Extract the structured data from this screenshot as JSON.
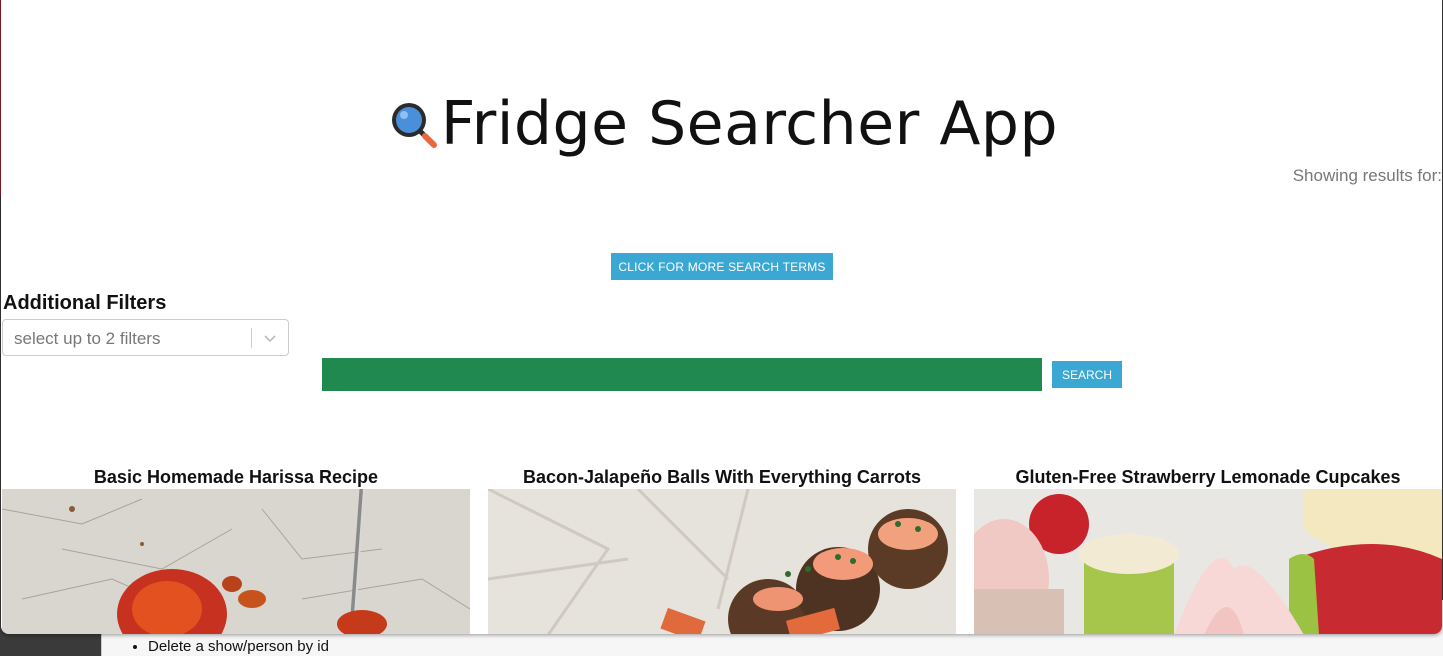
{
  "app": {
    "title": "Fridge Searcher App",
    "showing_results": "Showing results for:"
  },
  "buttons": {
    "more_terms": "CLICK FOR MORE SEARCH TERMS",
    "search": "SEARCH"
  },
  "filters": {
    "label": "Additional Filters",
    "placeholder": "select up to 2 filters"
  },
  "search": {
    "value": ""
  },
  "recipes": [
    {
      "title": "Basic Homemade Harissa Recipe",
      "image": "harissa-spoon-photo"
    },
    {
      "title": "Bacon-Jalapeño Balls With Everything Carrots",
      "image": "bacon-jalapeno-balls-photo"
    },
    {
      "title": "Gluten-Free Strawberry Lemonade Cupcakes",
      "image": "strawberry-cupcakes-photo"
    }
  ],
  "background_page": {
    "list_item": "Delete a show/person by id"
  },
  "colors": {
    "accent_button": "#3aa8d3",
    "search_bar": "#1f894f"
  },
  "icons": [
    "magnifier-icon",
    "chevron-down-icon"
  ]
}
